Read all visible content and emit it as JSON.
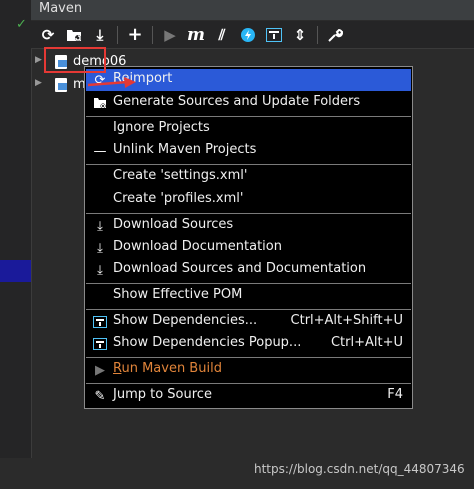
{
  "header": {
    "title": "Maven"
  },
  "toolbar": {
    "buttons": [
      {
        "icon": "refresh-icon",
        "glyph": "⟳"
      },
      {
        "icon": "folder-refresh-icon",
        "glyph": "📁"
      },
      {
        "icon": "download-icon",
        "glyph": "⤓"
      },
      {
        "icon": "add-icon",
        "glyph": "+"
      },
      {
        "icon": "run-icon",
        "glyph": "▶"
      },
      {
        "icon": "maven-goal-icon",
        "glyph": "m"
      },
      {
        "icon": "toggle-offline-icon",
        "glyph": "⫽"
      },
      {
        "icon": "skip-tests-icon",
        "glyph": "ϟ"
      },
      {
        "icon": "show-dependencies-icon",
        "glyph": "⊞"
      },
      {
        "icon": "collapse-all-icon",
        "glyph": "⇕"
      },
      {
        "icon": "settings-wrench-icon",
        "glyph": "🔧"
      }
    ]
  },
  "tree": {
    "items": [
      {
        "label": "demo06"
      },
      {
        "label": "m"
      }
    ]
  },
  "context_menu": {
    "items": [
      {
        "label": "Reimport",
        "icon": "reimport-icon",
        "glyph": "⟳",
        "highlighted": true
      },
      {
        "label": "Generate Sources and Update Folders",
        "icon": "generate-sources-icon",
        "glyph": "▣"
      },
      {
        "label": "Ignore Projects"
      },
      {
        "label": "Unlink Maven Projects",
        "icon": "minus-icon",
        "glyph": "—"
      },
      {
        "label": "Create 'settings.xml'"
      },
      {
        "label": "Create 'profiles.xml'"
      },
      {
        "label": "Download Sources",
        "icon": "download-icon",
        "glyph": "⤓"
      },
      {
        "label": "Download Documentation",
        "icon": "download-icon",
        "glyph": "⤓"
      },
      {
        "label": "Download Sources and Documentation",
        "icon": "download-icon",
        "glyph": "⤓"
      },
      {
        "label": "Show Effective POM"
      },
      {
        "label": "Show Dependencies...",
        "shortcut": "Ctrl+Alt+Shift+U",
        "icon": "dependencies-icon"
      },
      {
        "label": "Show Dependencies Popup...",
        "shortcut": "Ctrl+Alt+U",
        "icon": "dependencies-icon"
      },
      {
        "label_underlined": "R",
        "label_rest": "un Maven Build",
        "icon": "run-icon",
        "glyph": "▶",
        "disabled": true
      },
      {
        "label": "Jump to Source",
        "shortcut": "F4",
        "icon": "edit-pencil-icon",
        "glyph": "✎"
      }
    ]
  },
  "watermark": "https://blog.csdn.net/qq_44807346",
  "colors": {
    "highlight": "#2b5ad8",
    "annotation": "#e53935",
    "run_label": "#e0843a"
  }
}
